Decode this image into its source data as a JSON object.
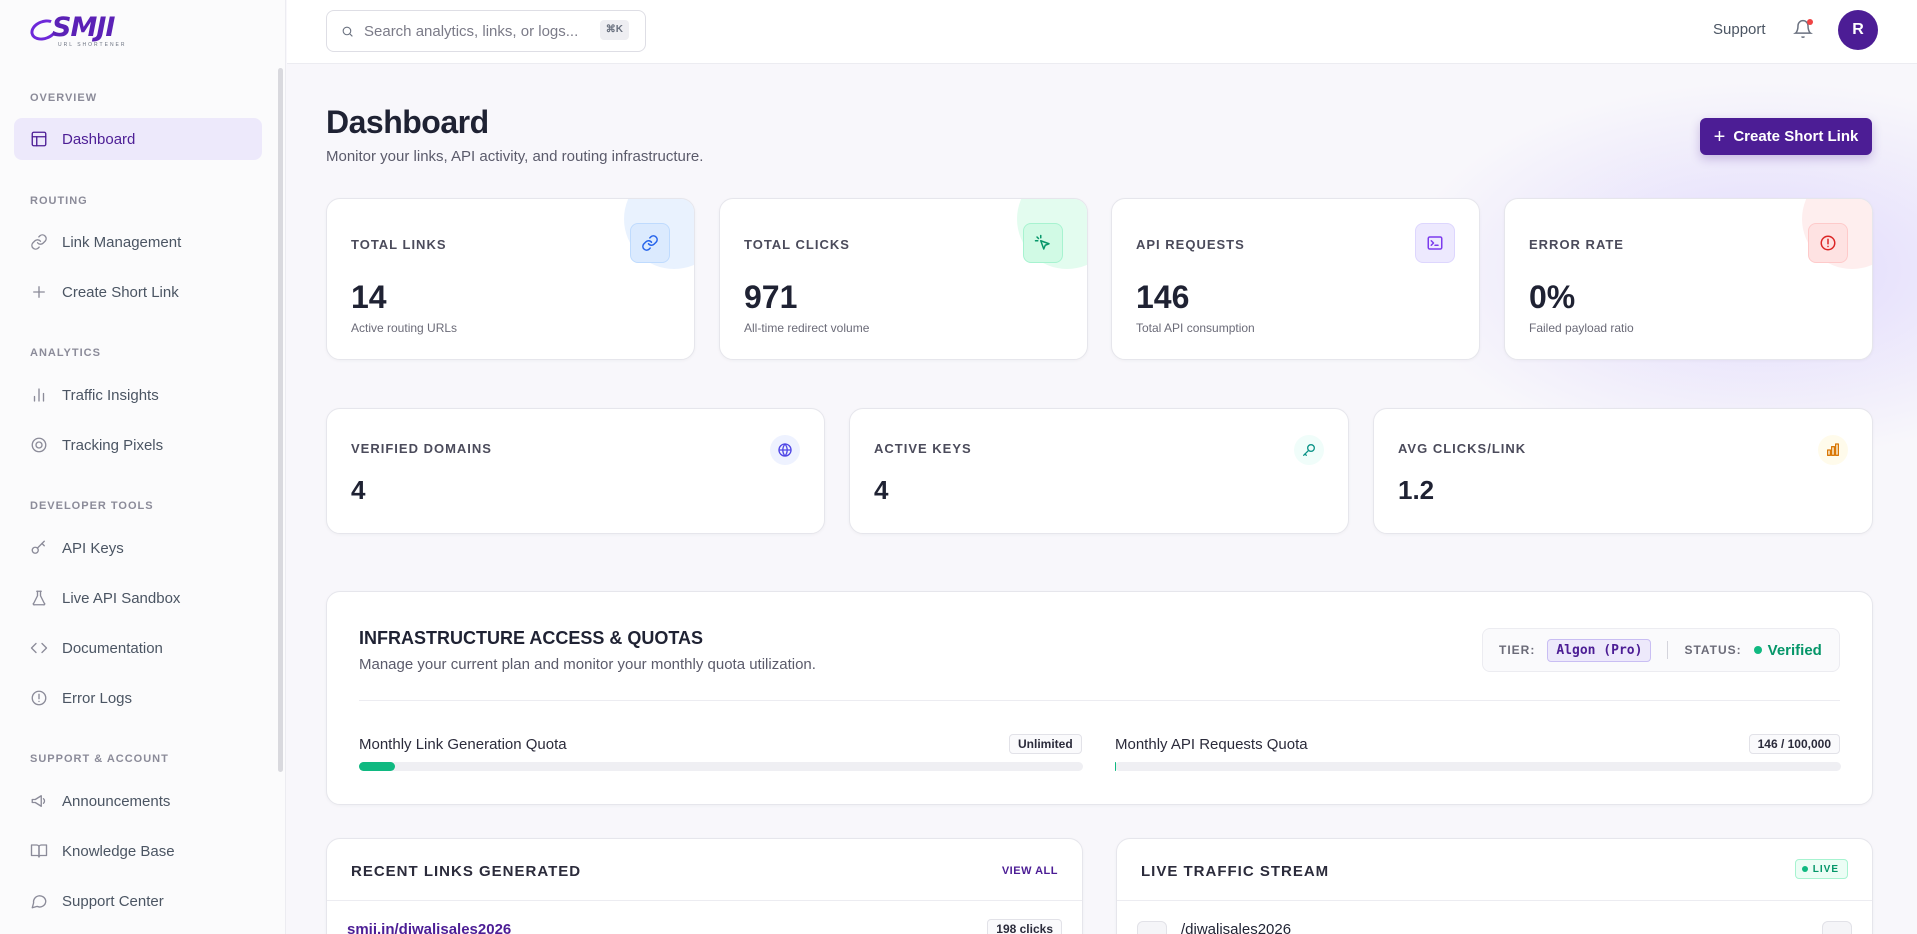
{
  "brand": {
    "logo_text": "SMJI",
    "logo_tagline": "URL SHORTENER"
  },
  "search": {
    "placeholder": "Search analytics, links, or logs...",
    "shortcut": "⌘K"
  },
  "header": {
    "support_label": "Support",
    "avatar_initial": "R"
  },
  "sidebar": {
    "sections": [
      {
        "title": "OVERVIEW",
        "items": [
          {
            "label": "Dashboard",
            "icon": "layout-icon",
            "active": true
          }
        ]
      },
      {
        "title": "ROUTING",
        "items": [
          {
            "label": "Link Management",
            "icon": "link-icon"
          },
          {
            "label": "Create Short Link",
            "icon": "plus-icon"
          }
        ]
      },
      {
        "title": "ANALYTICS",
        "items": [
          {
            "label": "Traffic Insights",
            "icon": "bar-chart-icon"
          },
          {
            "label": "Tracking Pixels",
            "icon": "target-icon"
          }
        ]
      },
      {
        "title": "DEVELOPER TOOLS",
        "items": [
          {
            "label": "API Keys",
            "icon": "key-icon"
          },
          {
            "label": "Live API Sandbox",
            "icon": "flask-icon"
          },
          {
            "label": "Documentation",
            "icon": "code-icon"
          },
          {
            "label": "Error Logs",
            "icon": "alert-circle-icon"
          }
        ]
      },
      {
        "title": "SUPPORT & ACCOUNT",
        "items": [
          {
            "label": "Announcements",
            "icon": "megaphone-icon"
          },
          {
            "label": "Knowledge Base",
            "icon": "book-icon"
          },
          {
            "label": "Support Center",
            "icon": "chat-icon"
          }
        ]
      }
    ]
  },
  "page": {
    "title": "Dashboard",
    "subtitle": "Monitor your links, API activity, and routing infrastructure.",
    "create_button": "Create Short Link"
  },
  "stats": [
    {
      "label": "TOTAL LINKS",
      "value": "14",
      "desc": "Active routing URLs",
      "icon": "link-icon",
      "color": "#2563eb",
      "bg": "#dbeafe"
    },
    {
      "label": "TOTAL CLICKS",
      "value": "971",
      "desc": "All-time redirect volume",
      "icon": "cursor-click-icon",
      "color": "#059669",
      "bg": "#d1fae5"
    },
    {
      "label": "API REQUESTS",
      "value": "146",
      "desc": "Total API consumption",
      "icon": "terminal-icon",
      "color": "#7c3aed",
      "bg": "#ede9fe"
    },
    {
      "label": "ERROR RATE",
      "value": "0%",
      "desc": "Failed payload ratio",
      "icon": "alert-circle-icon",
      "color": "#dc2626",
      "bg": "#fee2e2"
    }
  ],
  "mini_stats": [
    {
      "label": "VERIFIED DOMAINS",
      "value": "4",
      "icon": "globe-icon",
      "color": "#4f46e5",
      "bg": "#eef2ff"
    },
    {
      "label": "ACTIVE KEYS",
      "value": "4",
      "icon": "key-icon",
      "color": "#0d9488",
      "bg": "#f0fdfa"
    },
    {
      "label": "AVG CLICKS/LINK",
      "value": "1.2",
      "icon": "bar-chart-icon",
      "color": "#d97706",
      "bg": "#fffbeb"
    }
  ],
  "infra": {
    "title": "INFRASTRUCTURE ACCESS & QUOTAS",
    "subtitle": "Manage your current plan and monitor your monthly quota utilization.",
    "tier_label": "TIER:",
    "tier_value": "Algon (Pro)",
    "status_label": "STATUS:",
    "status_value": "Verified",
    "quotas": [
      {
        "label": "Monthly Link Generation Quota",
        "badge": "Unlimited",
        "fill_fraction": 0.05
      },
      {
        "label": "Monthly API Requests Quota",
        "badge": "146 / 100,000",
        "fill_fraction": 0.00146
      }
    ]
  },
  "recent_links": {
    "title": "RECENT LINKS GENERATED",
    "view_all": "VIEW ALL",
    "rows": [
      {
        "url": "smji.in/diwalisales2026",
        "clicks": "198 clicks"
      }
    ]
  },
  "live_stream": {
    "title": "LIVE TRAFFIC STREAM",
    "badge": "LIVE",
    "rows": [
      {
        "path": "/diwalisales2026"
      }
    ]
  }
}
